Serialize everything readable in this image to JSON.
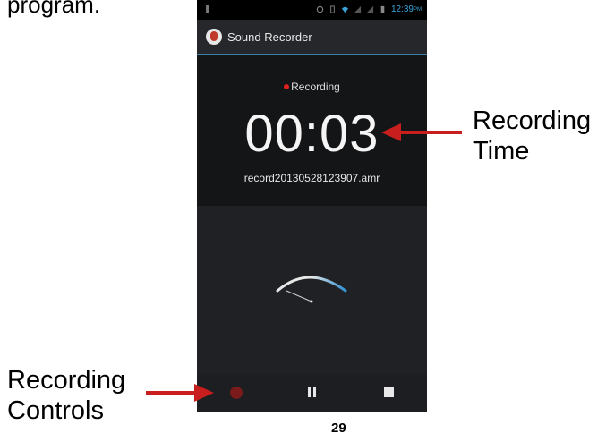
{
  "document": {
    "top_text": "program.",
    "annotation_time": "Recording Time",
    "annotation_controls": "Recording Controls",
    "page_number": "29"
  },
  "status_bar": {
    "time": "12:39",
    "ampm": "PM",
    "icons": [
      "debug-icon",
      "sync-icon",
      "wifi-icon",
      "signal-icon",
      "signal-icon",
      "battery-icon"
    ]
  },
  "action_bar": {
    "title": "Sound Recorder",
    "icon": "microphone-icon"
  },
  "recorder": {
    "status": "Recording",
    "elapsed": "00:03",
    "filename": "record20130528123907.amr"
  },
  "controls": {
    "record_icon": "record-icon",
    "pause_icon": "pause-icon",
    "stop_icon": "stop-icon"
  },
  "colors": {
    "accent": "#3aa3d8",
    "record_red": "#e02020",
    "arrow_red": "#c81e1e"
  }
}
